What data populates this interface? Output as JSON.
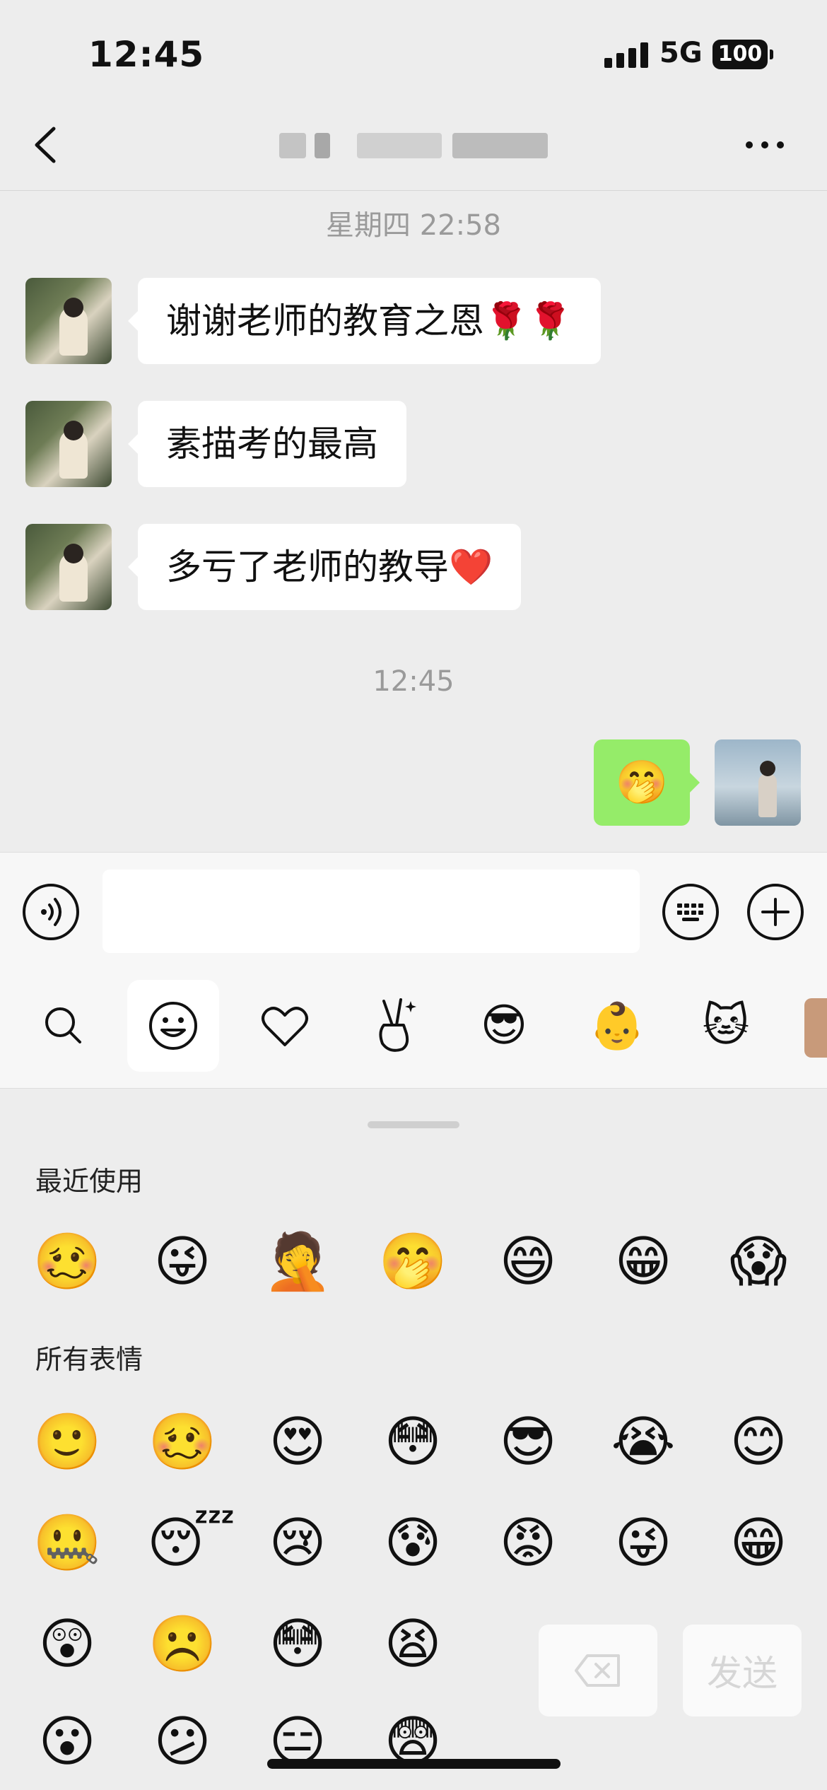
{
  "status_bar": {
    "time": "12:45",
    "network": "5G",
    "battery": "100"
  },
  "messages": [
    {
      "type": "timestamp",
      "text": "星期四 22:58"
    },
    {
      "type": "incoming",
      "text": "谢谢老师的教育之恩🌹🌹"
    },
    {
      "type": "incoming",
      "text": "素描考的最高"
    },
    {
      "type": "incoming",
      "text": "多亏了老师的教导❤️"
    },
    {
      "type": "timestamp",
      "text": "12:45"
    },
    {
      "type": "outgoing",
      "emoji": "🤭"
    }
  ],
  "input": {
    "value": "",
    "placeholder": ""
  },
  "emoji_tabs": [
    {
      "icon": "search-icon"
    },
    {
      "icon": "smiley-icon",
      "active": true
    },
    {
      "icon": "heart-icon"
    },
    {
      "icon": "victory-hand-icon",
      "glyph": "✌️"
    },
    {
      "icon": "sunglasses-emoji",
      "glyph": "😎"
    },
    {
      "icon": "baby-sticker",
      "glyph": "👶"
    },
    {
      "icon": "cat-sticker",
      "glyph": "🐱"
    }
  ],
  "sections": {
    "recent_title": "最近使用",
    "all_title": "所有表情"
  },
  "recent_emojis": [
    "🥴",
    "😜",
    "🤦",
    "🤭",
    "😄",
    "😁",
    "😱"
  ],
  "all_emojis": [
    [
      "🙂",
      "🥴",
      "😍",
      "😳",
      "😎",
      "😭",
      "😊"
    ],
    [
      "🤐",
      "😴",
      "😢",
      "😰",
      "😡",
      "😜",
      "😁"
    ],
    [
      "😲",
      "☹️",
      "😳",
      "😫"
    ],
    [
      "😮",
      "😕",
      "😑",
      "😨"
    ]
  ],
  "actions": {
    "send_label": "发送"
  },
  "colors": {
    "outgoing_bubble": "#95ec69",
    "background": "#ededed",
    "timestamp": "#9a9a9a"
  }
}
